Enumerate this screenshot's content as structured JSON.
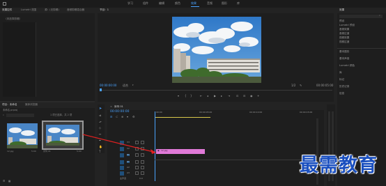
{
  "menu": {
    "items": [
      "学习",
      "组件",
      "编辑",
      "颜色",
      "效果",
      "音频",
      "图形",
      "库"
    ],
    "active_index": 4
  },
  "source_panel": {
    "tabs": [
      "效果控件",
      "Lumetri 范围",
      "源：(无剪辑)",
      "音频剪辑混合器"
    ],
    "empty_text": "（未选择剪辑）"
  },
  "program": {
    "tab": "节目：1",
    "timecode": "00:00:00:00",
    "fit": "适合",
    "scale": "1/2",
    "duration": "00:00:05:00"
  },
  "project": {
    "tabs": [
      "项目：未命名",
      "媒体浏览器"
    ],
    "file": "未命名.prproj",
    "count": "1 项已选择，共 2 项",
    "thumbnails": [
      {
        "label": "12.jpg",
        "duration": "5:00"
      },
      {
        "label": "序列 01",
        "duration": "5:00"
      }
    ]
  },
  "timeline": {
    "title": "序列 01",
    "timecode": "00:00:00:00",
    "ruler": [
      "00:00",
      "00:00:05:00",
      "00:00:10:00",
      "00:00:15:00"
    ],
    "video_tracks": [
      "V3",
      "V2",
      "V1"
    ],
    "audio_tracks": [
      "A1",
      "A2",
      "A3"
    ],
    "master": "主声道",
    "master_value": "0.0",
    "clip_label": "12.jpg"
  },
  "effects": {
    "tab": "效果",
    "tree": [
      "预设",
      "Lumetri 预设",
      "音频效果",
      "音频过渡",
      "视频效果",
      "视频过渡"
    ],
    "sections": [
      "基本图形",
      "基本声音",
      "Lumetri 颜色",
      "库",
      "标记",
      "历史记录",
      "信息"
    ]
  },
  "watermark": "最需教育",
  "colors": {
    "accent": "#4aa3ff",
    "clip": "#e07ad8",
    "arrow": "#e02020",
    "watermark": "#1a4fbf"
  }
}
